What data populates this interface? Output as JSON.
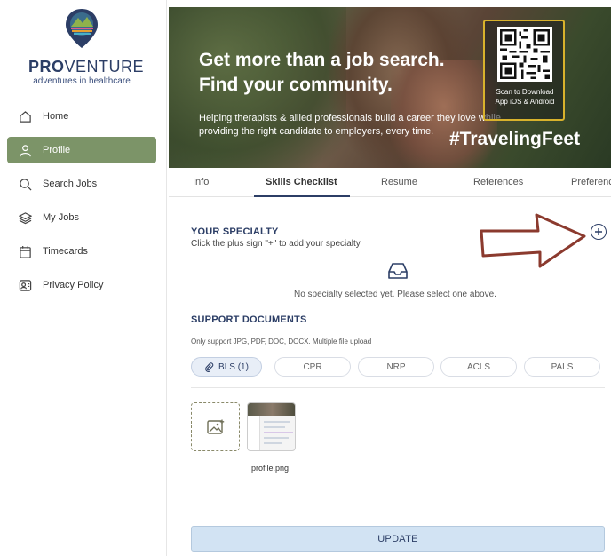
{
  "logo": {
    "pro": "PRO",
    "venture": "VENTURE",
    "tagline": "adventures in healthcare"
  },
  "nav": [
    {
      "label": "Home",
      "icon": "home-icon"
    },
    {
      "label": "Profile",
      "icon": "user-icon",
      "active": true
    },
    {
      "label": "Search Jobs",
      "icon": "search-icon"
    },
    {
      "label": "My Jobs",
      "icon": "layers-icon"
    },
    {
      "label": "Timecards",
      "icon": "calendar-icon"
    },
    {
      "label": "Privacy Policy",
      "icon": "privacy-icon"
    }
  ],
  "banner": {
    "title_line1": "Get more than a job search.",
    "title_line2": "Find your community.",
    "subtitle": "Helping therapists & allied professionals build a career they love while providing the right candidate to employers, every time.",
    "hashtag": "#TravelingFeet",
    "qr_caption_line1": "Scan to Download",
    "qr_caption_line2": "App iOS & Android"
  },
  "tabs": [
    {
      "label": "Info"
    },
    {
      "label": "Skills Checklist",
      "active": true
    },
    {
      "label": "Resume"
    },
    {
      "label": "References"
    },
    {
      "label": "Preferences"
    }
  ],
  "specialty": {
    "title": "YOUR SPECIALTY",
    "hint": "Click the plus sign \"+\" to add your specialty",
    "empty": "No specialty selected yet. Please select one above."
  },
  "support": {
    "title": "SUPPORT DOCUMENTS",
    "hint": "Only support JPG, PDF, DOC, DOCX. Multiple file upload",
    "doc_tabs": [
      {
        "label": "BLS (1)",
        "active": true
      },
      {
        "label": "CPR"
      },
      {
        "label": "NRP"
      },
      {
        "label": "ACLS"
      },
      {
        "label": "PALS"
      }
    ],
    "file_name": "profile.png"
  },
  "update_label": "UPDATE",
  "colors": {
    "primary": "#2c3e66",
    "accent": "#7c9468",
    "button_bg": "#d2e3f3",
    "arrow": "#8b3a2e"
  }
}
